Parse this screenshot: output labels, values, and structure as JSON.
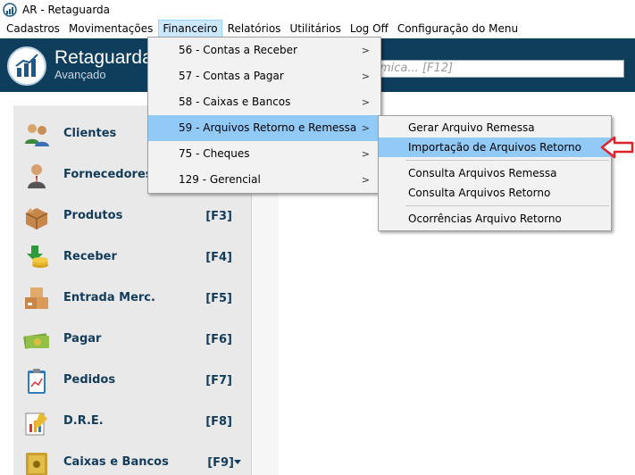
{
  "window": {
    "title": "AR - Retaguarda"
  },
  "menubar": [
    {
      "label": "Cadastros"
    },
    {
      "label": "Movimentações"
    },
    {
      "label": "Financeiro"
    },
    {
      "label": "Relatórios"
    },
    {
      "label": "Utilitários"
    },
    {
      "label": "Log Off"
    },
    {
      "label": "Configuração do Menu"
    }
  ],
  "header": {
    "brand": "Retaguarda",
    "subtitle": "Avançado",
    "search_placeholder": "mica... [F12]"
  },
  "sidebar": [
    {
      "label": "Clientes",
      "key": "",
      "icon": "clients-icon"
    },
    {
      "label": "Fornecedores",
      "key": "",
      "icon": "supplier-icon"
    },
    {
      "label": "Produtos",
      "key": "[F3]",
      "icon": "box-icon"
    },
    {
      "label": "Receber",
      "key": "[F4]",
      "icon": "money-receive-icon"
    },
    {
      "label": "Entrada Merc.",
      "key": "[F5]",
      "icon": "goods-entry-icon"
    },
    {
      "label": "Pagar",
      "key": "[F6]",
      "icon": "banknote-icon"
    },
    {
      "label": "Pedidos",
      "key": "[F7]",
      "icon": "clipboard-icon"
    },
    {
      "label": "D.R.E.",
      "key": "[F8]",
      "icon": "report-icon"
    },
    {
      "label": "Caixas e Bancos",
      "key": "[F9]",
      "icon": "safe-icon"
    }
  ],
  "financeiro_menu": [
    {
      "label": "56 - Contas a Receber"
    },
    {
      "label": "57 - Contas a Pagar"
    },
    {
      "label": "58 - Caixas e Bancos"
    },
    {
      "label": "59 - Arquivos Retorno e Remessa"
    },
    {
      "label": "75 - Cheques"
    },
    {
      "label": "129 - Gerencial"
    }
  ],
  "submenu": {
    "group1": [
      {
        "label": "Gerar Arquivo Remessa"
      },
      {
        "label": "Importação de Arquivos Retorno"
      }
    ],
    "group2": [
      {
        "label": "Consulta Arquivos Remessa"
      },
      {
        "label": "Consulta Arquivos Retorno"
      }
    ],
    "group3": [
      {
        "label": "Ocorrências Arquivo Retorno"
      }
    ]
  },
  "colors": {
    "header": "#0f3d5c",
    "highlight": "#91c9f7",
    "annotation": "#e0232a",
    "sidebar_text": "#123c5a"
  }
}
